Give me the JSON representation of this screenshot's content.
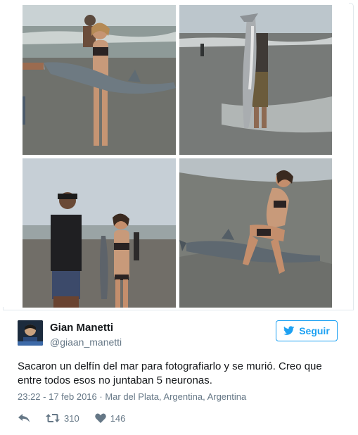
{
  "tweet": {
    "display_name": "Gian Manetti",
    "handle": "@giaan_manetti",
    "follow_label": "Seguir",
    "text": "Sacaron un delfín del mar para fotografiarlo y se murió. Creo que entre todos esos no juntaban 5 neuronas.",
    "timestamp": "23:22 - 17 feb 2016",
    "separator": " · ",
    "location": "Mar del Plata, Argentina, Argentina",
    "retweets": "310",
    "likes": "146"
  },
  "icons": {
    "follow": "bird-icon",
    "reply": "reply-icon",
    "retweet": "retweet-icon",
    "like": "heart-icon"
  },
  "colors": {
    "accent": "#1da1f2",
    "text": "#14171a",
    "muted": "#657786",
    "border": "#e1e8ed"
  }
}
